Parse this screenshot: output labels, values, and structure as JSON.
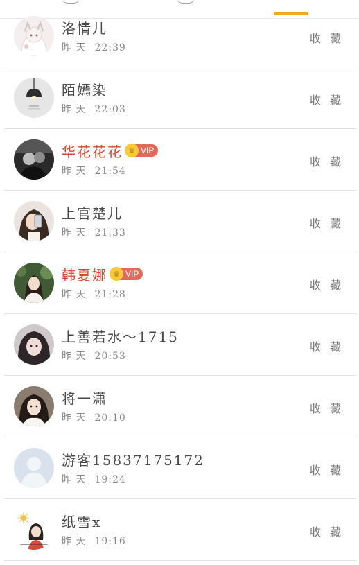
{
  "colors": {
    "accent": "#f0a81e",
    "vip_name": "#d8492f",
    "vip_badge": "#e06b5a"
  },
  "favorite_label": "收 藏",
  "day_label": "昨 天",
  "users": [
    {
      "name": "洛情儿",
      "time": "22:39",
      "vip": false,
      "vip_label": "",
      "avatar_icon": "anime-girl-avatar"
    },
    {
      "name": "陌嫣染",
      "time": "22:03",
      "vip": false,
      "vip_label": "",
      "avatar_icon": "lamp-avatar"
    },
    {
      "name": "华花花花",
      "time": "21:54",
      "vip": true,
      "vip_label": "VIP",
      "avatar_icon": "couple-photo-avatar"
    },
    {
      "name": "上官楚儿",
      "time": "21:33",
      "vip": false,
      "vip_label": "",
      "avatar_icon": "selfie-girl-avatar"
    },
    {
      "name": "韩夏娜",
      "time": "21:28",
      "vip": true,
      "vip_label": "VIP",
      "avatar_icon": "garden-girl-avatar"
    },
    {
      "name": "上善若水～1715",
      "time": "20:53",
      "vip": false,
      "vip_label": "",
      "avatar_icon": "portrait-girl-avatar"
    },
    {
      "name": "将一潇",
      "time": "20:10",
      "vip": false,
      "vip_label": "",
      "avatar_icon": "dark-hair-girl-avatar"
    },
    {
      "name": "游客15837175172",
      "time": "19:24",
      "vip": false,
      "vip_label": "",
      "avatar_icon": "default-user-avatar"
    },
    {
      "name": "纸雪x",
      "time": "19:16",
      "vip": false,
      "vip_label": "",
      "avatar_icon": "cartoon-girl-avatar"
    }
  ]
}
